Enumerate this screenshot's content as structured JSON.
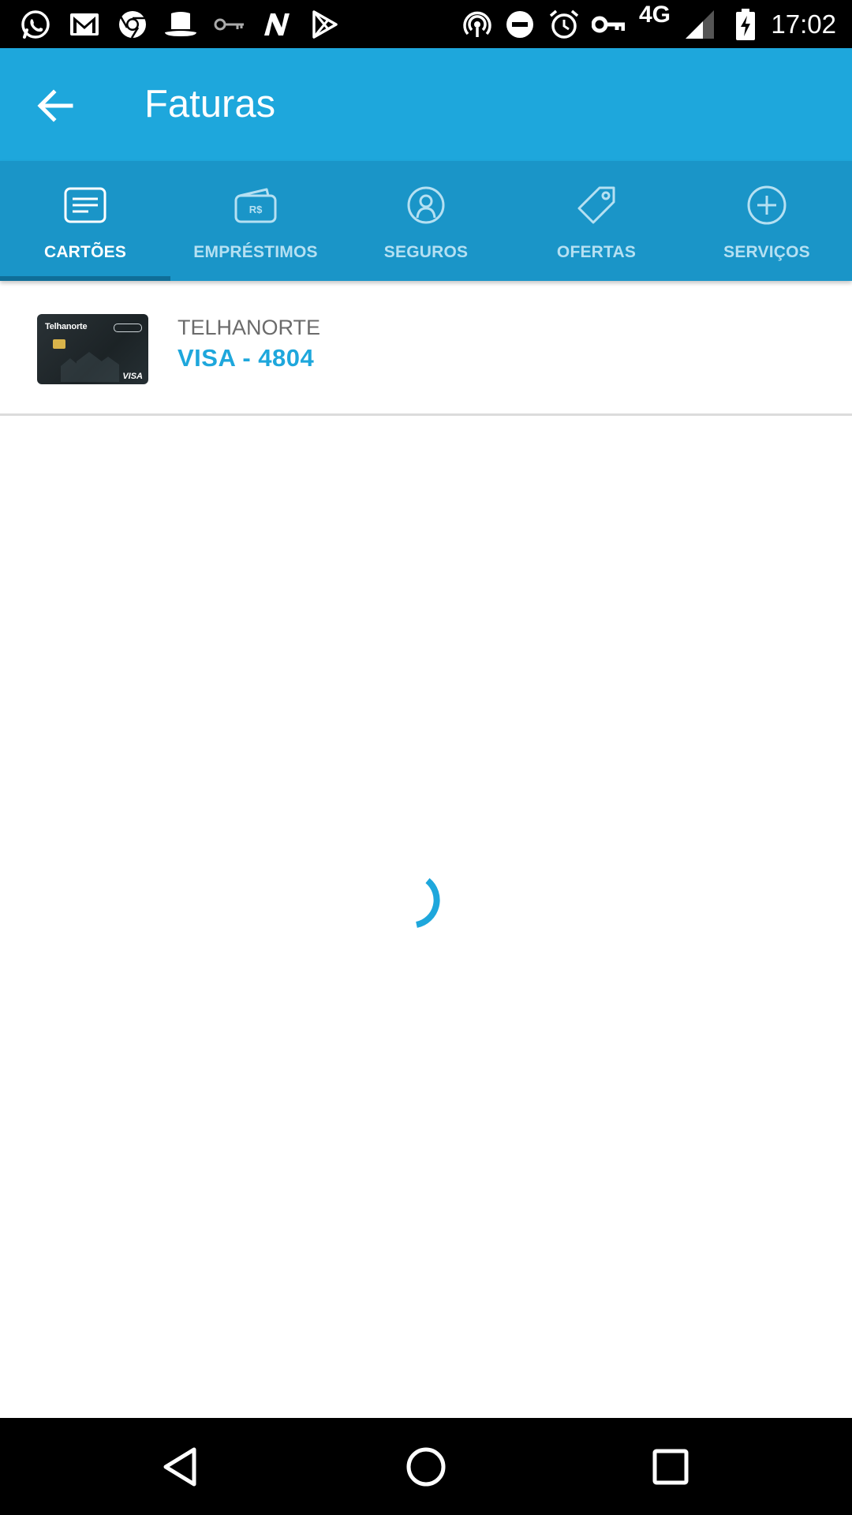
{
  "status_bar": {
    "network": "4G",
    "time": "17:02",
    "notification_icons": [
      "whatsapp-icon",
      "gmail-icon",
      "chrome-icon",
      "top-hat-icon",
      "key-icon",
      "n-icon",
      "play-store-icon"
    ],
    "system_icons": [
      "hotspot-icon",
      "do-not-disturb-icon",
      "alarm-icon",
      "vpn-key-icon",
      "signal-icon",
      "battery-charging-icon"
    ]
  },
  "app_bar": {
    "title": "Faturas",
    "back_icon": "arrow-back-icon"
  },
  "tabs": [
    {
      "label": "CARTÕES",
      "icon": "card-icon",
      "active": true
    },
    {
      "label": "EMPRÉSTIMOS",
      "icon": "money-icon",
      "active": false
    },
    {
      "label": "SEGUROS",
      "icon": "user-circle-icon",
      "active": false
    },
    {
      "label": "OFERTAS",
      "icon": "tag-icon",
      "active": false
    },
    {
      "label": "SERVIÇOS",
      "icon": "plus-circle-icon",
      "active": false
    }
  ],
  "card": {
    "issuer": "TELHANORTE",
    "number": "VISA - 4804",
    "thumb_brand": "Telhanorte",
    "thumb_network": "VISA"
  },
  "loading": {
    "indicator": "spinner"
  },
  "nav_bar": {
    "buttons": [
      "back-triangle-icon",
      "home-circle-icon",
      "recents-square-icon"
    ]
  },
  "colors": {
    "app_bar": "#1ea7dc",
    "tab_bar": "#1a95c8",
    "accent": "#1ea7dc",
    "status_bar": "#000000"
  }
}
